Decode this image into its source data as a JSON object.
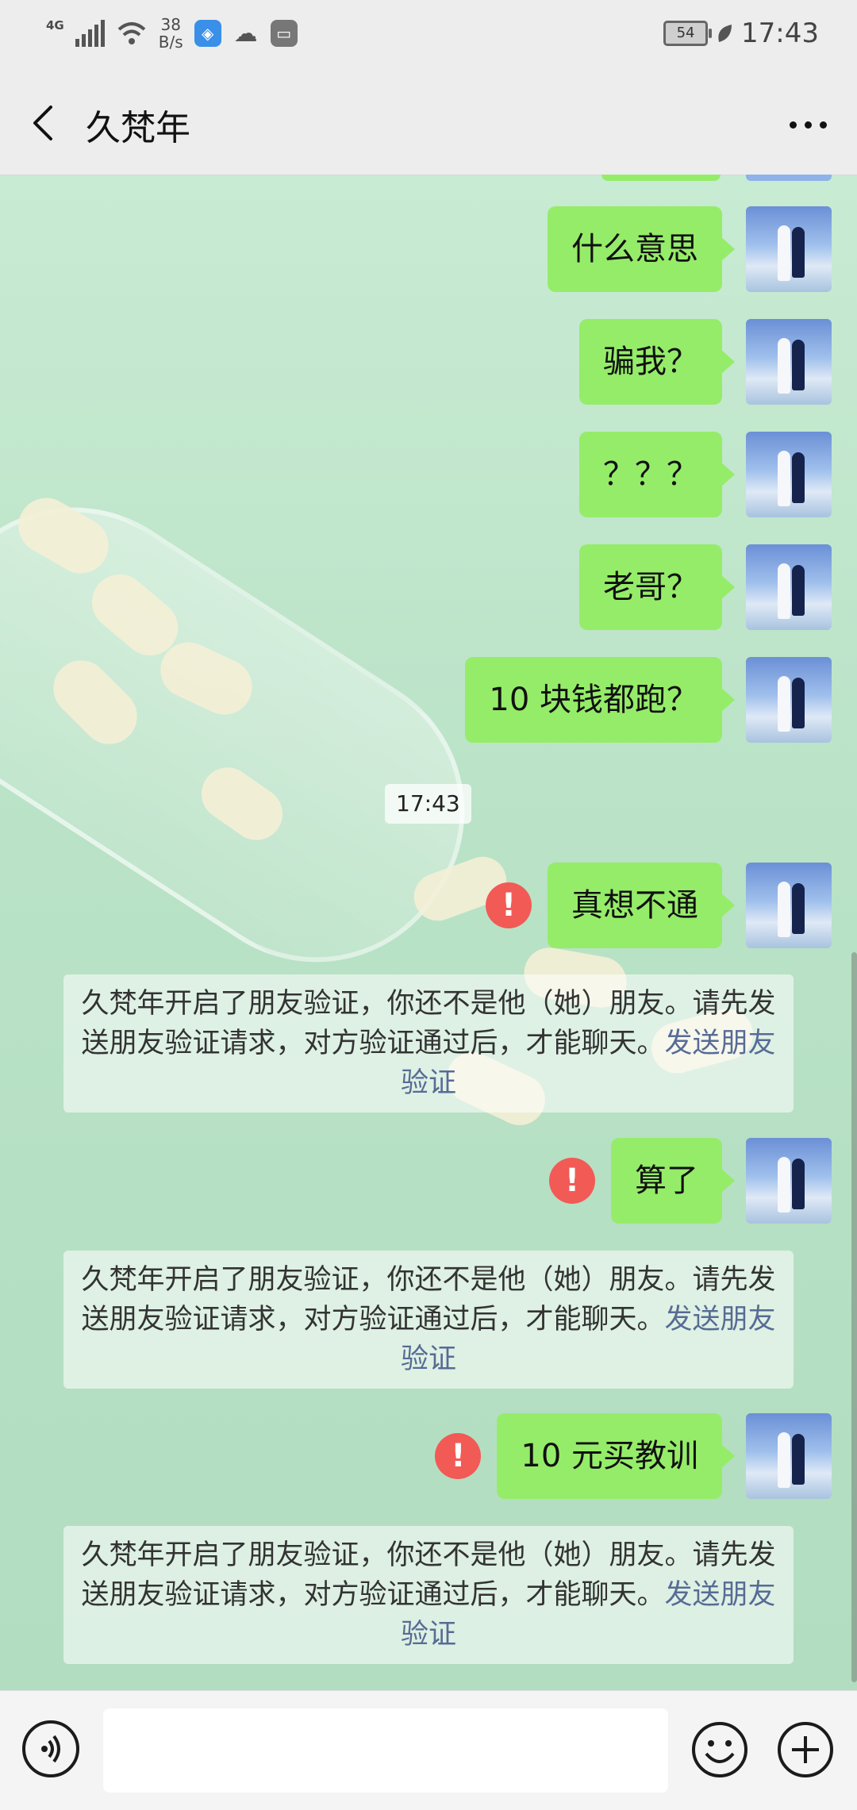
{
  "status_bar": {
    "network": "4G",
    "speed_value": "38",
    "speed_unit": "B/s",
    "battery": "54",
    "time": "17:43"
  },
  "header": {
    "title": "久梵年"
  },
  "messages": [
    {
      "text": "什么意思",
      "failed": false
    },
    {
      "text": "骗我？",
      "failed": false
    },
    {
      "text": "？？？",
      "failed": false
    },
    {
      "text": "老哥？",
      "failed": false
    },
    {
      "text": "10 块钱都跑？",
      "failed": false
    },
    {
      "text": "真想不通",
      "failed": true
    },
    {
      "text": "算了",
      "failed": true
    },
    {
      "text": "10 元买教训",
      "failed": true
    }
  ],
  "timestamp": "17:43",
  "system_notice": {
    "text": "久梵年开启了朋友验证，你还不是他（她）朋友。请先发送朋友验证请求，对方验证通过后，才能聊天。",
    "link": "发送朋友验证"
  },
  "error_mark": "!",
  "input": {
    "value": "",
    "placeholder": ""
  },
  "colors": {
    "bubble_green": "#95ec69",
    "error_red": "#f25a56",
    "link_blue": "#576b95"
  }
}
